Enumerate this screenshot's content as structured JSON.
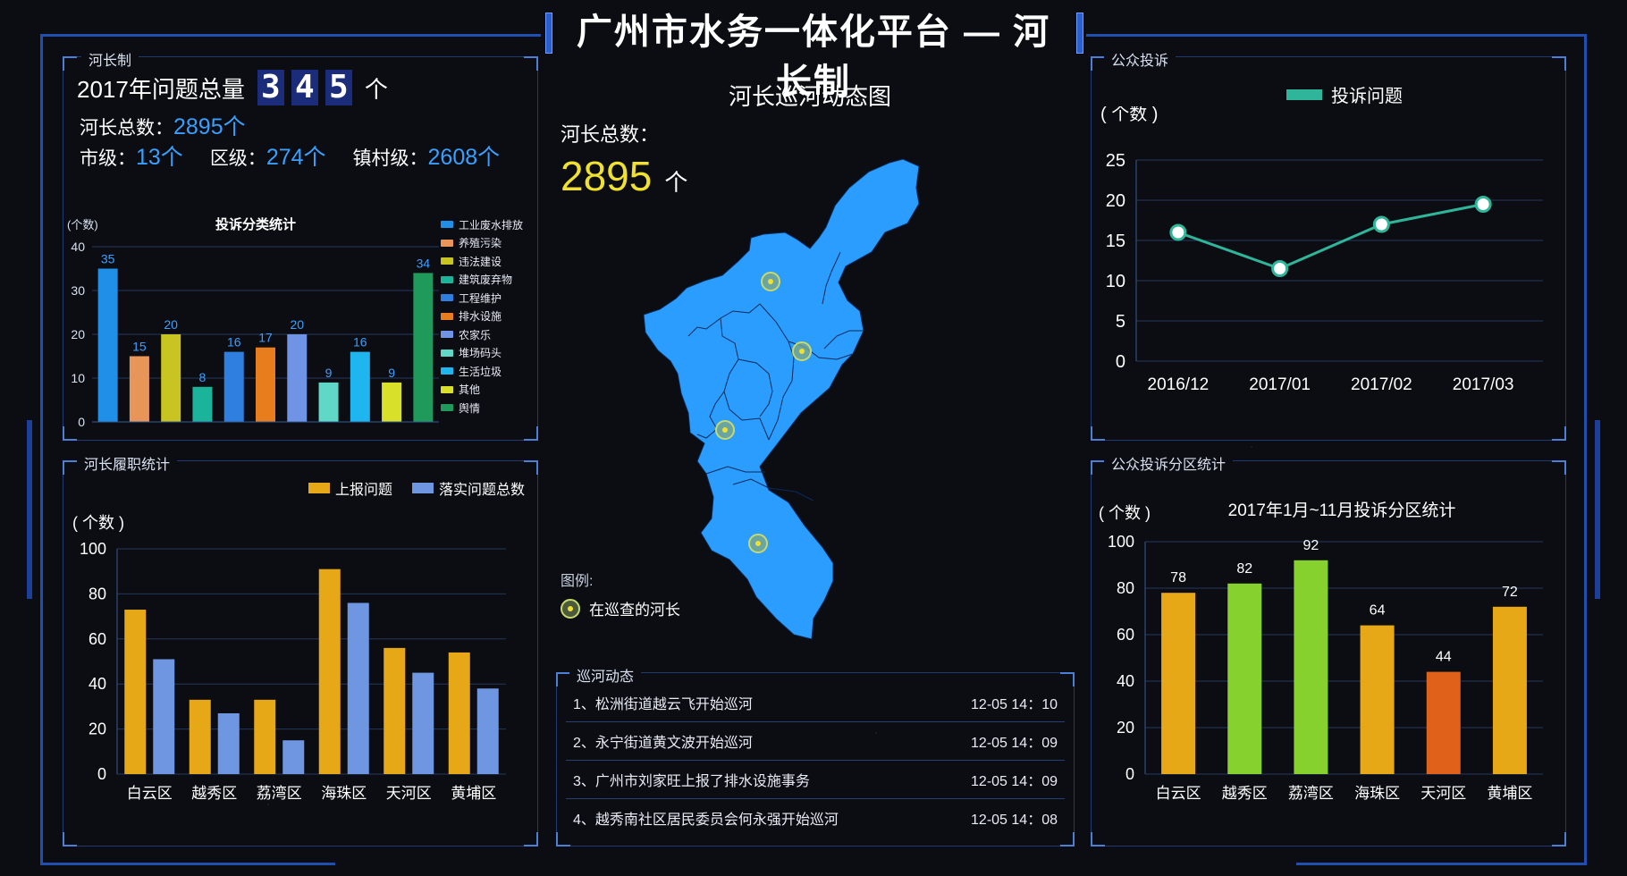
{
  "header": {
    "title": "广州市水务一体化平台 — 河长制"
  },
  "river_chief_panel": {
    "title": "河长制",
    "total_label": "2017年问题总量",
    "total_digits": [
      "3",
      "4",
      "5"
    ],
    "total_unit": "个",
    "chief_total_label": "河长总数：",
    "chief_total_value": "2895个",
    "city_label": "市级：",
    "city_value": "13个",
    "district_label": "区级：",
    "district_value": "274个",
    "town_label": "镇村级：",
    "town_value": "2608个"
  },
  "complaint_category_chart": {
    "chart_data": {
      "type": "bar",
      "title": "投诉分类统计",
      "ylabel": "(个数)",
      "ylim": [
        0,
        40
      ],
      "yticks": [
        0,
        10,
        20,
        30,
        40
      ],
      "categories": [
        "工业废水排放",
        "养殖污染",
        "违法建设",
        "建筑废弃物",
        "工程维护",
        "排水设施",
        "农家乐",
        "堆场码头",
        "生活垃圾",
        "其他",
        "舆情"
      ],
      "values": [
        35,
        15,
        20,
        8,
        16,
        17,
        20,
        9,
        16,
        9,
        34
      ],
      "colors": [
        "#1f8fe8",
        "#e8955a",
        "#c8c421",
        "#1bb39a",
        "#2f7fe0",
        "#e87d1e",
        "#6f94e6",
        "#5fd8c8",
        "#1fb6f0",
        "#d8e02a",
        "#1f9a5a"
      ]
    }
  },
  "performance_panel": {
    "title": "河长履职统计",
    "chart_data": {
      "type": "bar",
      "ylabel": "( 个数 )",
      "ylim": [
        0,
        100
      ],
      "yticks": [
        0,
        20,
        40,
        60,
        80,
        100
      ],
      "categories": [
        "白云区",
        "越秀区",
        "荔湾区",
        "海珠区",
        "天河区",
        "黄埔区"
      ],
      "series": [
        {
          "name": "上报问题",
          "values": [
            73,
            33,
            33,
            91,
            56,
            54
          ],
          "color": "#e6a817"
        },
        {
          "name": "落实问题总数",
          "values": [
            51,
            27,
            15,
            76,
            45,
            38
          ],
          "color": "#6f96e0"
        }
      ]
    }
  },
  "map_panel": {
    "title": "河长巡河动态图",
    "chief_total_label": "河长总数：",
    "chief_total_value": "2895",
    "chief_total_unit": "个",
    "legend_title": "图例:",
    "legend_item": "在巡查的河长",
    "map_color": "#2b9dff"
  },
  "patrol_panel": {
    "title": "巡河动态",
    "rows": [
      {
        "text": "1、松洲街道越云飞开始巡河",
        "time": "12-05  14：10"
      },
      {
        "text": "2、永宁街道黄文波开始巡河",
        "time": "12-05  14：09"
      },
      {
        "text": "3、广州市刘家旺上报了排水设施事务",
        "time": "12-05  14：09"
      },
      {
        "text": "4、越秀南社区居民委员会何永强开始巡河",
        "time": "12-05  14：08"
      }
    ]
  },
  "complaint_panel": {
    "title": "公众投诉",
    "chart_data": {
      "type": "line",
      "ylabel": "( 个数 )",
      "ylim": [
        0,
        25
      ],
      "yticks": [
        0,
        5,
        10,
        15,
        20,
        25
      ],
      "x": [
        "2016/12",
        "2017/01",
        "2017/02",
        "2017/03"
      ],
      "series": [
        {
          "name": "投诉问题",
          "values": [
            16,
            11.5,
            17,
            19.5
          ],
          "color": "#2fb59a"
        }
      ]
    }
  },
  "district_complaint_panel": {
    "title": "公众投诉分区统计",
    "chart_data": {
      "type": "bar",
      "title": "2017年1月~11月投诉分区统计",
      "ylabel": "( 个数 )",
      "ylim": [
        0,
        100
      ],
      "yticks": [
        0,
        20,
        40,
        60,
        80,
        100
      ],
      "categories": [
        "白云区",
        "越秀区",
        "荔湾区",
        "海珠区",
        "天河区",
        "黄埔区"
      ],
      "values": [
        78,
        82,
        92,
        64,
        44,
        72
      ],
      "colors": [
        "#e6a817",
        "#86d12e",
        "#86d12e",
        "#e6a817",
        "#e0611a",
        "#e6a817"
      ]
    }
  }
}
